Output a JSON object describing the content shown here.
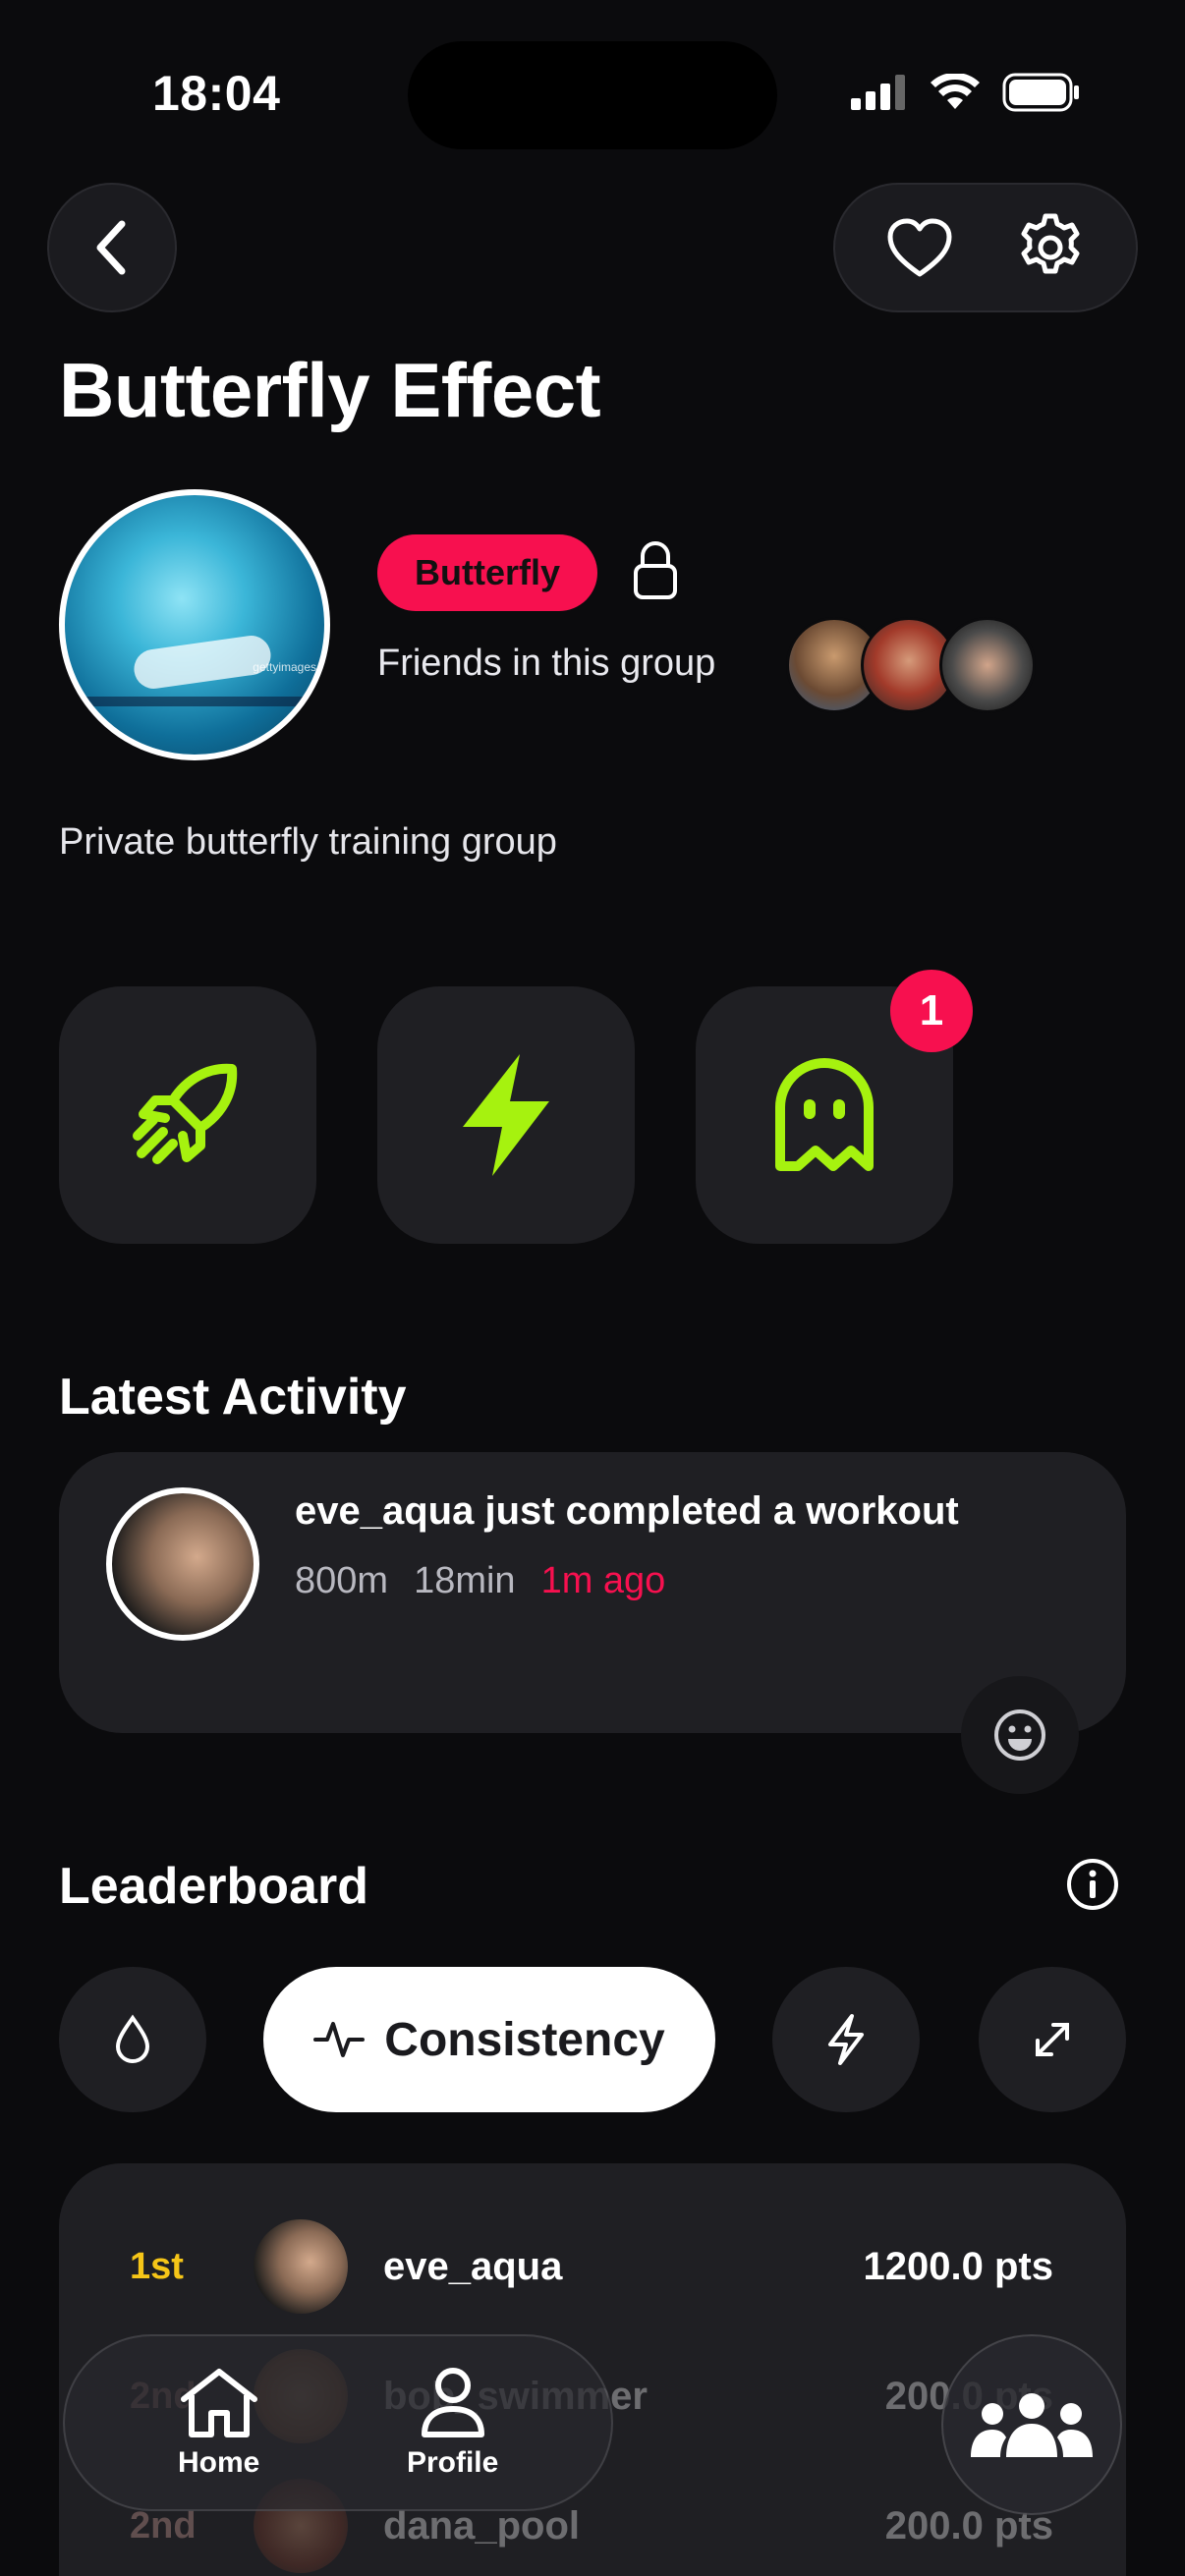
{
  "status_bar": {
    "time": "18:04"
  },
  "header": {
    "title": "Butterfly Effect"
  },
  "group": {
    "tag": "Butterfly",
    "friends_label": "Friends in this group",
    "description": "Private butterfly training group",
    "photo_credit": "gettyimages"
  },
  "tiles": [
    {
      "icon": "rocket-icon"
    },
    {
      "icon": "lightning-icon"
    },
    {
      "icon": "ghost-icon",
      "badge": "1"
    }
  ],
  "activity": {
    "section_title": "Latest Activity",
    "title": "eve_aqua just completed a workout",
    "distance": "800m",
    "duration": "18min",
    "ago": "1m ago"
  },
  "leaderboard": {
    "section_title": "Leaderboard",
    "active_filter": "Consistency",
    "rows": [
      {
        "rank": "1st",
        "name": "eve_aqua",
        "points": "1200.0 pts"
      },
      {
        "rank": "2nd",
        "name": "bob_swimmer",
        "points": "200.0 pts"
      },
      {
        "rank": "2nd",
        "name": "dana_pool",
        "points": "200.0 pts"
      }
    ]
  },
  "nav": {
    "home": "Home",
    "profile": "Profile"
  },
  "colors": {
    "accent": "#f7104f",
    "lime": "#a6f20f",
    "gold": "#f5c518"
  }
}
